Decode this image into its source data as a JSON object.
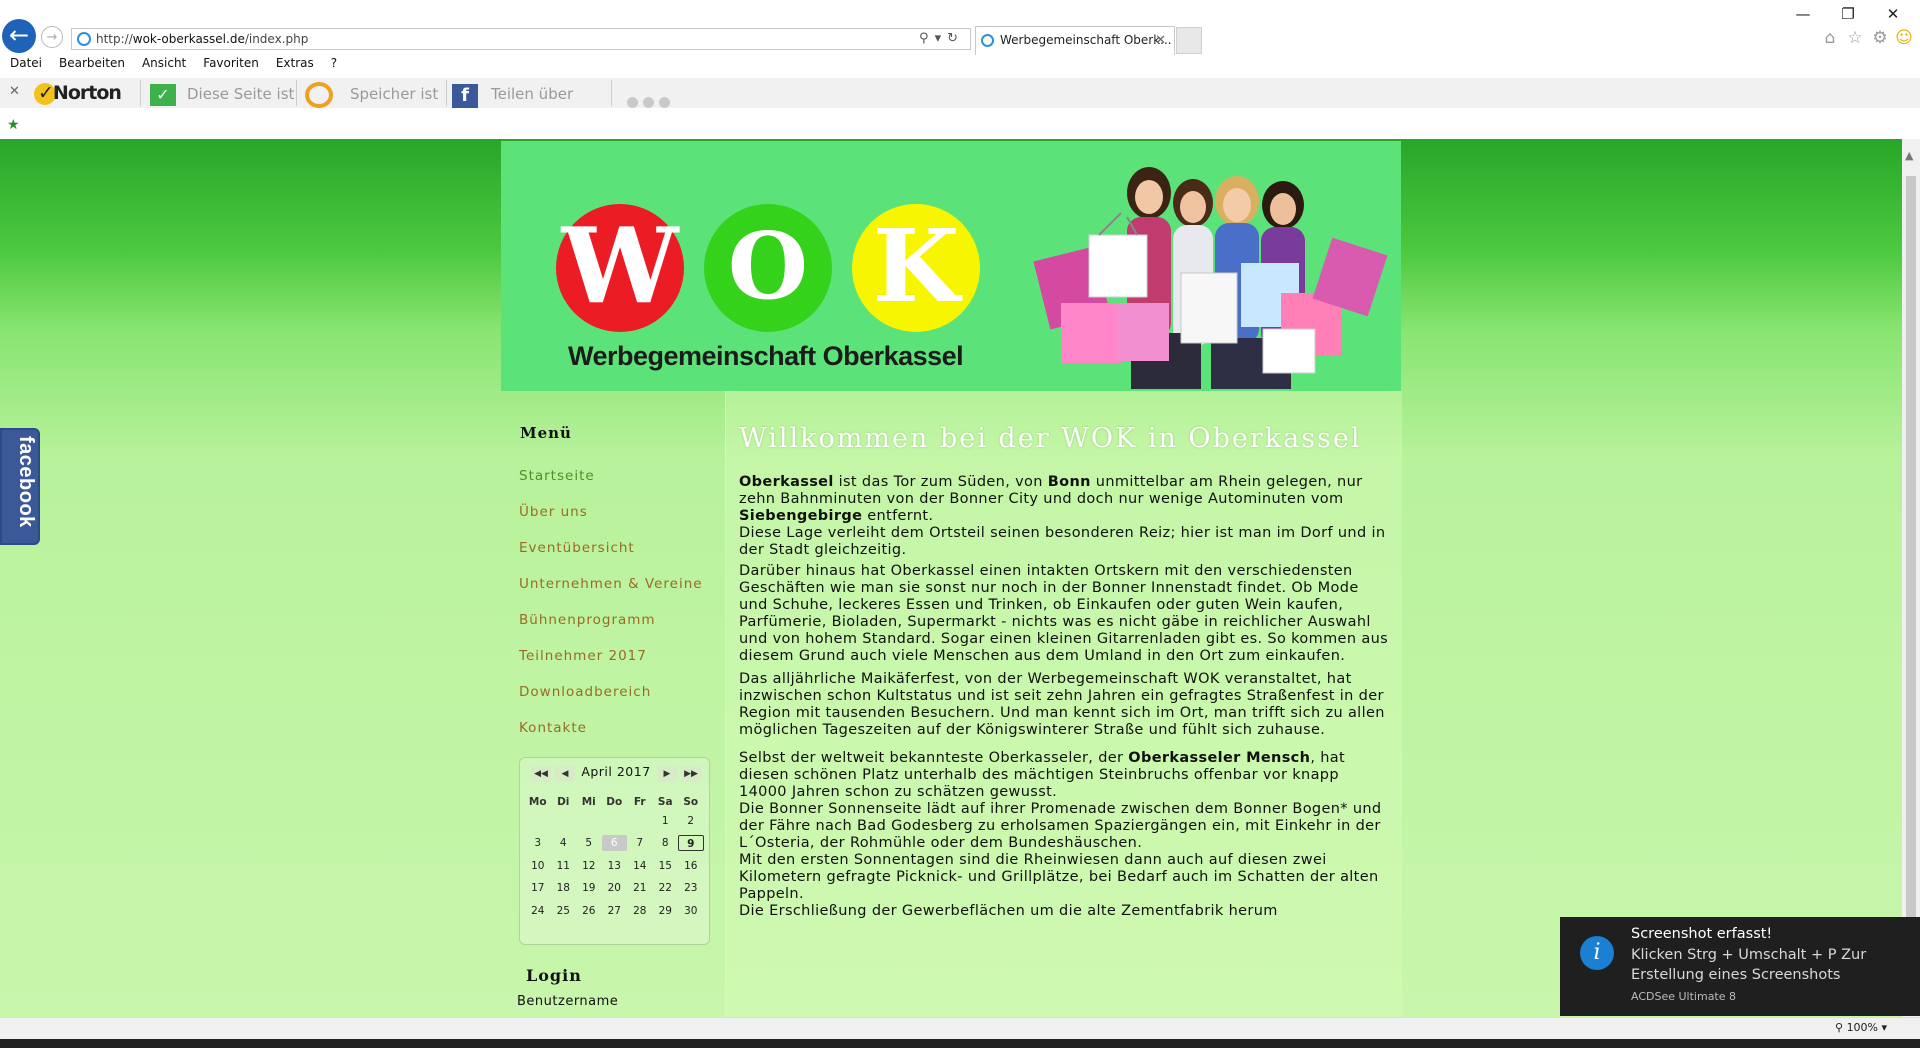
{
  "browser": {
    "url_prefix": "http://",
    "url_host": "wok-oberkassel.de",
    "url_path": "/index.php",
    "tab_title": "Werbegemeinschaft Oberk...",
    "menu": [
      "Datei",
      "Bearbeiten",
      "Ansicht",
      "Favoriten",
      "Extras",
      "?"
    ],
    "toolbar": {
      "norton": "Norton",
      "safe_page": "Diese Seite ist",
      "storage": "Speicher ist",
      "share": "Teilen über"
    },
    "window_controls": {
      "minimize": "—",
      "restore": "❐",
      "close": "✕"
    },
    "zoom": "100%"
  },
  "site": {
    "logo_letters": [
      "W",
      "O",
      "K"
    ],
    "logo_subtitle": "Werbegemeinschaft Oberkassel",
    "facebook_tab": "facebook"
  },
  "sidebar": {
    "menu_title": "Menü",
    "items": [
      {
        "label": "Startseite"
      },
      {
        "label": "Über uns"
      },
      {
        "label": "Eventübersicht"
      },
      {
        "label": "Unternehmen & Vereine"
      },
      {
        "label": "Bühnenprogramm"
      },
      {
        "label": "Teilnehmer 2017"
      },
      {
        "label": "Downloadbereich"
      },
      {
        "label": "Kontakte"
      }
    ],
    "calendar": {
      "month": "April 2017",
      "weekdays": [
        "Mo",
        "Di",
        "Mi",
        "Do",
        "Fr",
        "Sa",
        "So"
      ],
      "weeks": [
        [
          "",
          "",
          "",
          "",
          "",
          "1",
          "2"
        ],
        [
          "3",
          "4",
          "5",
          "6",
          "7",
          "8",
          "9"
        ],
        [
          "10",
          "11",
          "12",
          "13",
          "14",
          "15",
          "16"
        ],
        [
          "17",
          "18",
          "19",
          "20",
          "21",
          "22",
          "23"
        ],
        [
          "24",
          "25",
          "26",
          "27",
          "28",
          "29",
          "30"
        ]
      ],
      "today": "6",
      "selected": "9"
    },
    "login_title": "Login",
    "username_label": "Benutzername"
  },
  "content": {
    "title": "Willkommen bei der WOK in Oberkassel",
    "p1": {
      "b1": "Oberkassel",
      "t1": " ist das Tor zum Süden, von ",
      "b2": "Bonn",
      "t2": " unmittelbar am Rhein gelegen, nur zehn Bahnminuten von der Bonner City und doch nur wenige Autominuten vom ",
      "b3": "Siebengebirge",
      "t3": " entfernt."
    },
    "p2": "Diese Lage verleiht dem Ortsteil seinen besonderen Reiz; hier ist man im Dorf und in der Stadt gleichzeitig.",
    "p3": "Darüber hinaus hat Oberkassel einen intakten Ortskern mit den verschiedensten Geschäften wie man sie sonst nur noch in der Bonner Innenstadt findet. Ob Mode und Schuhe, leckeres Essen und Trinken, ob Einkaufen oder guten Wein kaufen, Parfümerie, Bioladen, Supermarkt - nichts was es nicht gäbe in reichlicher Auswahl und von hohem Standard. Sogar einen kleinen Gitarrenladen gibt es. So kommen aus diesem Grund auch viele Menschen aus dem Umland in den Ort zum einkaufen.",
    "p4": "Das alljährliche Maikäferfest, von der Werbegemeinschaft WOK veranstaltet, hat inzwischen schon Kultstatus und ist seit zehn Jahren ein gefragtes Straßenfest in der Region mit tausenden Besuchern. Und man kennt sich im Ort, man trifft sich zu allen möglichen Tageszeiten auf der Königswinterer Straße und fühlt sich zuhause.",
    "p5": {
      "t1": "Selbst der weltweit bekannteste Oberkasseler, der ",
      "b1": "Oberkasseler Mensch",
      "t2": ", hat diesen schönen Platz unterhalb des mächtigen Steinbruchs offenbar vor knapp 14000 Jahren schon zu schätzen gewusst."
    },
    "p6": "Die Bonner Sonnenseite lädt auf ihrer Promenade zwischen dem Bonner Bogen* und der Fähre nach Bad Godesberg zu erholsamen Spaziergängen ein, mit Einkehr in der L´Osteria, der Rohmühle oder dem Bundeshäuschen.",
    "p7": "Mit den ersten Sonnentagen sind die Rheinwiesen dann auch auf diesen zwei Kilometern gefragte Picknick- und Grillplätze, bei Bedarf auch im Schatten der alten Pappeln.",
    "p8": "Die Erschließung der Gewerbeflächen um die alte Zementfabrik herum"
  },
  "toast": {
    "title": "Screenshot erfasst!",
    "line1": "Klicken Strg + Umschalt + P Zur",
    "line2": "Erstellung eines Screenshots",
    "app": "ACDSee Ultimate 8"
  },
  "colors": {
    "header_bg": "#5be37a",
    "logo_red": "#ec1c24",
    "logo_green": "#35d21c",
    "logo_yellow": "#f8f500",
    "menu_link": "#9a6b24",
    "facebook_blue": "#3b5998"
  }
}
